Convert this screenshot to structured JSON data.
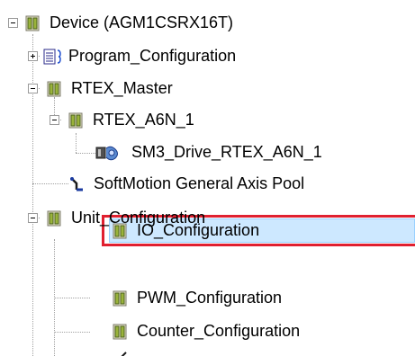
{
  "tree": {
    "nodes": [
      {
        "label": "Device (AGM1CSRX16T)",
        "expander": "minus",
        "icon": "device-module-icon"
      },
      {
        "label": "Program_Configuration",
        "expander": "plus",
        "icon": "program-config-icon"
      },
      {
        "label": "RTEX_Master",
        "expander": "minus",
        "icon": "device-module-icon"
      },
      {
        "label": "RTEX_A6N_1",
        "expander": "minus",
        "icon": "device-module-icon"
      },
      {
        "label": "SM3_Drive_RTEX_A6N_1",
        "expander": "none",
        "icon": "servo-drive-icon"
      },
      {
        "label": "SoftMotion General Axis Pool",
        "expander": "none",
        "icon": "axis-pool-icon"
      },
      {
        "label": "Unit_Configuration",
        "expander": "minus",
        "icon": "device-module-icon"
      },
      {
        "label": "IO_Configuration",
        "expander": "none",
        "icon": "device-module-icon",
        "selected": true
      },
      {
        "label": "PWM_Configuration",
        "expander": "none",
        "icon": "device-module-icon"
      },
      {
        "label": "Counter_Configuration",
        "expander": "none",
        "icon": "device-module-icon"
      }
    ]
  },
  "colors": {
    "selection_fill": "#cde8ff",
    "selection_border": "#99d1ff",
    "highlight_frame": "#e02030"
  }
}
